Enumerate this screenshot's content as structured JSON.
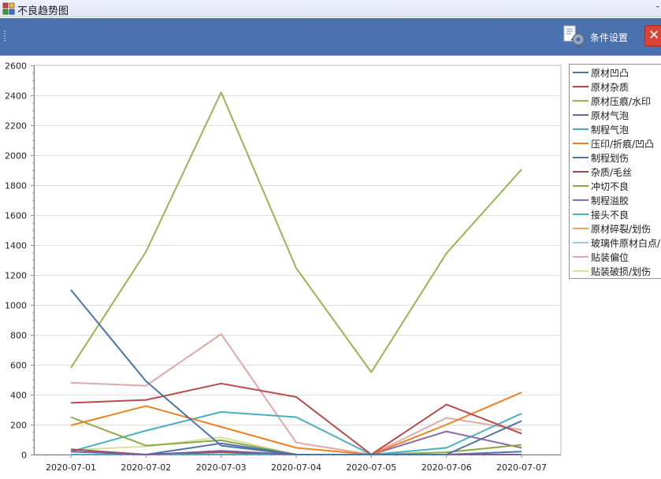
{
  "window": {
    "title": "不良趋势图",
    "title_right": "-"
  },
  "toolbar": {
    "condition_label": "条件设置"
  },
  "chart_data": {
    "type": "line",
    "categories": [
      "2020-07-01",
      "2020-07-02",
      "2020-07-03",
      "2020-07-04",
      "2020-07-05",
      "2020-07-06",
      "2020-07-07"
    ],
    "ylim": [
      0,
      2600
    ],
    "yticks": [
      0,
      200,
      400,
      600,
      800,
      1000,
      1200,
      1400,
      1600,
      1800,
      2000,
      2200,
      2400,
      2600
    ],
    "grid": true,
    "legend": "right",
    "series": [
      {
        "name": "原材凹凸",
        "color": "#4e73a6",
        "values": [
          1100,
          490,
          60,
          0,
          0,
          0,
          225
        ]
      },
      {
        "name": "原材杂质",
        "color": "#b84a4a",
        "values": [
          345,
          365,
          475,
          385,
          0,
          335,
          140
        ]
      },
      {
        "name": "原材压痕/水印",
        "color": "#97b552",
        "values": [
          580,
          1355,
          2420,
          1245,
          550,
          1345,
          1905
        ]
      },
      {
        "name": "原材气泡",
        "color": "#7b5ea0",
        "values": [
          20,
          0,
          25,
          0,
          0,
          0,
          0
        ]
      },
      {
        "name": "制程气泡",
        "color": "#4aa8b8",
        "values": [
          0,
          0,
          0,
          0,
          0,
          0,
          0
        ]
      },
      {
        "name": "压印/折痕/凹凸",
        "color": "#f08020",
        "values": [
          195,
          325,
          185,
          45,
          0,
          200,
          415
        ]
      },
      {
        "name": "制程划伤",
        "color": "#4e73a6",
        "values": [
          0,
          0,
          75,
          0,
          0,
          0,
          20
        ]
      },
      {
        "name": "杂质/毛丝",
        "color": "#a04a4a",
        "values": [
          35,
          0,
          15,
          0,
          0,
          0,
          0
        ]
      },
      {
        "name": "冲切不良",
        "color": "#8ea848",
        "values": [
          250,
          60,
          95,
          0,
          0,
          15,
          65
        ]
      },
      {
        "name": "制程溢胶",
        "color": "#8a6aaa",
        "values": [
          0,
          0,
          0,
          0,
          0,
          155,
          45
        ]
      },
      {
        "name": "接头不良",
        "color": "#4ab0c0",
        "values": [
          20,
          160,
          285,
          250,
          0,
          45,
          275
        ]
      },
      {
        "name": "原材碎裂/划伤",
        "color": "#f0a050",
        "values": [
          0,
          0,
          0,
          0,
          0,
          0,
          0
        ]
      },
      {
        "name": "玻璃件原材白点/",
        "color": "#a8c8e8",
        "values": [
          0,
          0,
          0,
          0,
          0,
          0,
          0
        ]
      },
      {
        "name": "贴装偏位",
        "color": "#e0a8a8",
        "values": [
          480,
          460,
          805,
          80,
          0,
          245,
          165
        ]
      },
      {
        "name": "贴装破损/划伤",
        "color": "#d8e0a0",
        "values": [
          30,
          55,
          115,
          0,
          0,
          0,
          0
        ]
      }
    ]
  }
}
